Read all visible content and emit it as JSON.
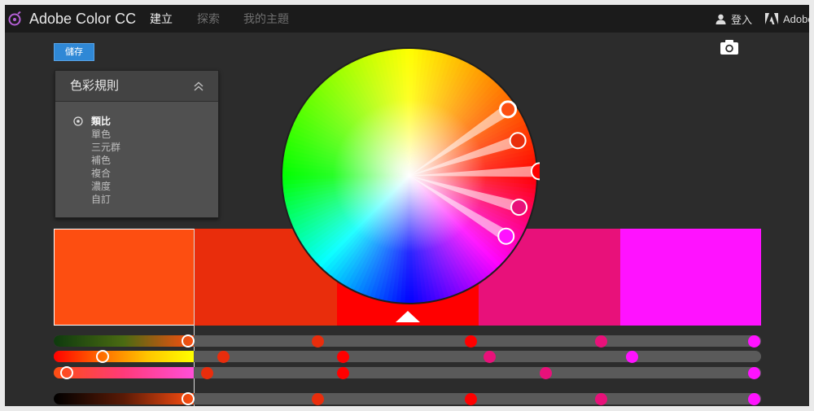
{
  "app": {
    "title": "Adobe Color CC"
  },
  "nav": {
    "create": "建立",
    "explore": "探索",
    "my_themes": "我的主題"
  },
  "header_right": {
    "login": "登入",
    "adobe": "Adobe"
  },
  "toolbar": {
    "save_label": "儲存"
  },
  "panel": {
    "title": "色彩規則",
    "rules": [
      "類比",
      "單色",
      "三元群",
      "補色",
      "複合",
      "濃度",
      "自訂"
    ],
    "selected_index": 0
  },
  "theme": {
    "colors": [
      "#fd4e11",
      "#e92d0c",
      "#ff0000",
      "#e8117a",
      "#ff12ff"
    ],
    "base_index": 0,
    "selected_swatch": 0,
    "active_swatch": 2
  },
  "icons": {
    "brand": "adobe-color-logo-icon",
    "user": "user-icon",
    "adobe": "adobe-logo-icon",
    "camera": "camera-icon",
    "collapse": "chevron-up-icon",
    "radio": "radio-selected-icon",
    "pointer": "triangle-up-icon"
  }
}
